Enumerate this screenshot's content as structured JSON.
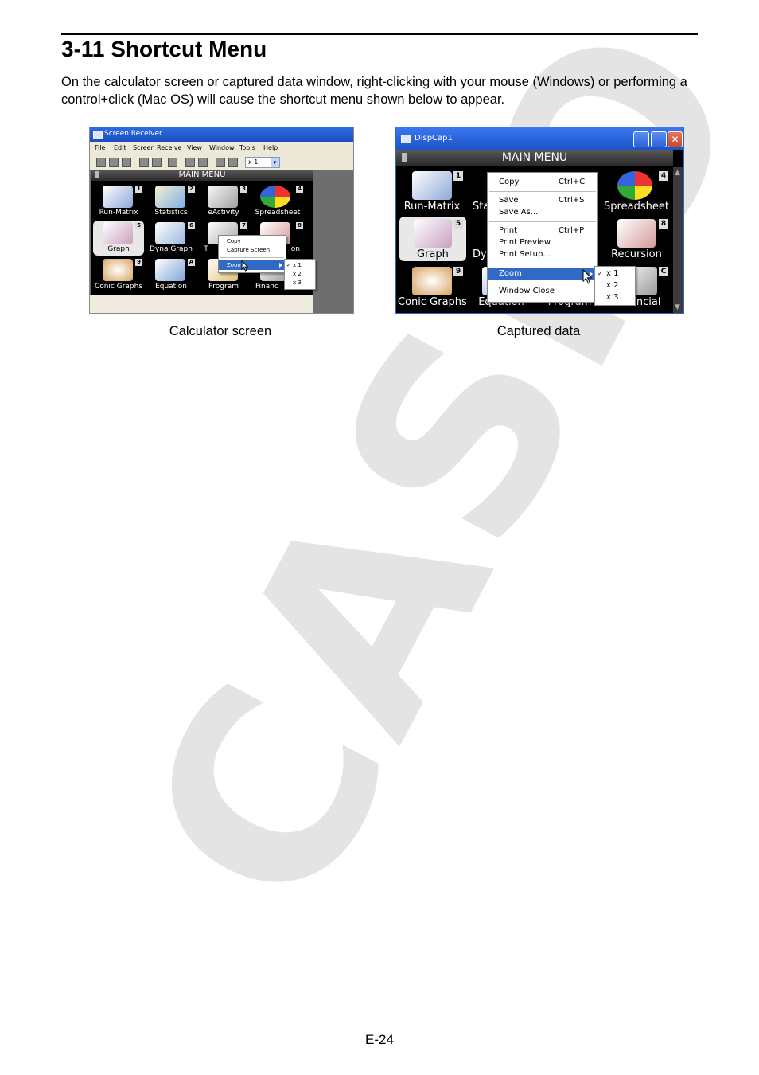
{
  "section": {
    "title": "3-11 Shortcut Menu"
  },
  "intro": "On the calculator screen or captured data window, right-clicking with your mouse (Windows) or performing a control+click (Mac OS) will cause the shortcut menu shown below to appear.",
  "calculator_screen": {
    "window_title": "Screen Receiver",
    "menus": [
      "File",
      "Edit",
      "Screen Receive",
      "View",
      "Window",
      "Tools",
      "Help"
    ],
    "zoom_value": "x 1",
    "header": "MAIN MENU",
    "apps": [
      {
        "label": "Run-Matrix",
        "num": "1"
      },
      {
        "label": "Statistics",
        "num": "2"
      },
      {
        "label": "eActivity",
        "num": "3"
      },
      {
        "label": "Spreadsheet",
        "num": "4"
      },
      {
        "label": "Graph",
        "num": "5"
      },
      {
        "label": "Dyna Graph",
        "num": "6"
      },
      {
        "label": "T",
        "num": "7"
      },
      {
        "label": "on",
        "num": "8"
      },
      {
        "label": "Conic Graphs",
        "num": "9"
      },
      {
        "label": "Equation",
        "num": "A"
      },
      {
        "label": "Program",
        "num": ""
      },
      {
        "label": "Financ",
        "num": ""
      }
    ],
    "context_menu": [
      "Copy",
      "Capture Screen",
      "Zoom"
    ],
    "zoom_submenu": [
      "x 1",
      "x 2",
      "x 3"
    ],
    "caption": "Calculator screen"
  },
  "captured_data": {
    "window_title": "DispCap1",
    "header": "MAIN MENU",
    "apps": [
      {
        "label": "Run-Matrix",
        "num": "1"
      },
      {
        "label": "Sta",
        "num": ""
      },
      {
        "label": "Spreadsheet",
        "num": "4"
      },
      {
        "label": "Graph",
        "num": "5"
      },
      {
        "label": "Dyn",
        "num": ""
      },
      {
        "label": "Recursion",
        "num": "8"
      },
      {
        "label": "Conic Graphs",
        "num": "9"
      },
      {
        "label": "Equation",
        "num": ""
      },
      {
        "label": "Program",
        "num": ""
      },
      {
        "label": "Financial",
        "num": "C"
      }
    ],
    "context_menu": [
      {
        "label": "Copy",
        "shortcut": "Ctrl+C"
      },
      {
        "label": "Save",
        "shortcut": "Ctrl+S"
      },
      {
        "label": "Save As...",
        "shortcut": ""
      },
      {
        "label": "Print",
        "shortcut": "Ctrl+P"
      },
      {
        "label": "Print Preview",
        "shortcut": ""
      },
      {
        "label": "Print Setup...",
        "shortcut": ""
      },
      {
        "label": "Zoom",
        "shortcut": ""
      },
      {
        "label": "Window Close",
        "shortcut": ""
      }
    ],
    "zoom_submenu": [
      "x 1",
      "x 2",
      "x 3"
    ],
    "caption": "Captured data"
  },
  "watermark": "CASIO",
  "page_number": "E-24",
  "colors": {
    "menu_highlight": "#316ac5",
    "titlebar": "#2e6de0",
    "watermark": "#e6e6e6"
  }
}
